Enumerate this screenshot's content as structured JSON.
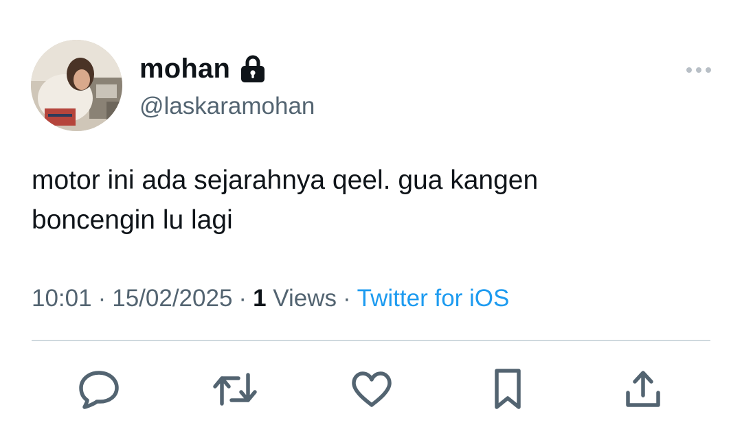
{
  "tweet": {
    "author": {
      "display_name": "mohan",
      "handle": "@laskaramohan",
      "protected": true
    },
    "text": "motor ini ada sejarahnya qeel. gua kangen\nboncengin lu lagi",
    "meta": {
      "time": "10:01",
      "date": "15/02/2025",
      "views_count": "1",
      "views_label": "Views",
      "separator": "·",
      "source": "Twitter for iOS"
    },
    "actions": [
      "reply-icon",
      "retweet-icon",
      "like-icon",
      "bookmark-icon",
      "share-icon"
    ]
  },
  "colors": {
    "text_primary": "#0f1419",
    "text_secondary": "#536471",
    "link": "#1d9bf0",
    "divider": "#cfd9de"
  }
}
